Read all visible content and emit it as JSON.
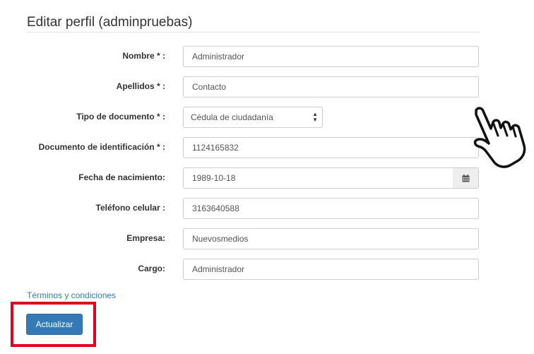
{
  "page": {
    "title": "Editar perfil (adminpruebas)"
  },
  "form": {
    "nombre": {
      "label": "Nombre * :",
      "value": "Administrador"
    },
    "apellidos": {
      "label": "Apellidos * :",
      "value": "Contacto"
    },
    "tipo_documento": {
      "label": "Tipo de documento * :",
      "selected": "Cédula de ciudadanía",
      "icon": "select-arrows-icon"
    },
    "documento": {
      "label": "Documento de identificación * :",
      "value": "1124165832"
    },
    "fecha_nacimiento": {
      "label": "Fecha de nacimiento:",
      "value": "1989-10-18",
      "icon": "calendar-icon"
    },
    "telefono": {
      "label": "Teléfono celular :",
      "value": "3163640588"
    },
    "empresa": {
      "label": "Empresa:",
      "value": "Nuevosmedios"
    },
    "cargo": {
      "label": "Cargo:",
      "value": "Administrador"
    }
  },
  "links": {
    "terms": "Términos y condiciones"
  },
  "actions": {
    "update_label": "Actualizar"
  },
  "annotations": {
    "highlight_color": "#e3001b",
    "pointer": "hand-pointer-icon"
  },
  "colors": {
    "primary": "#337ab7",
    "link": "#337ab7",
    "border": "#cccccc"
  }
}
